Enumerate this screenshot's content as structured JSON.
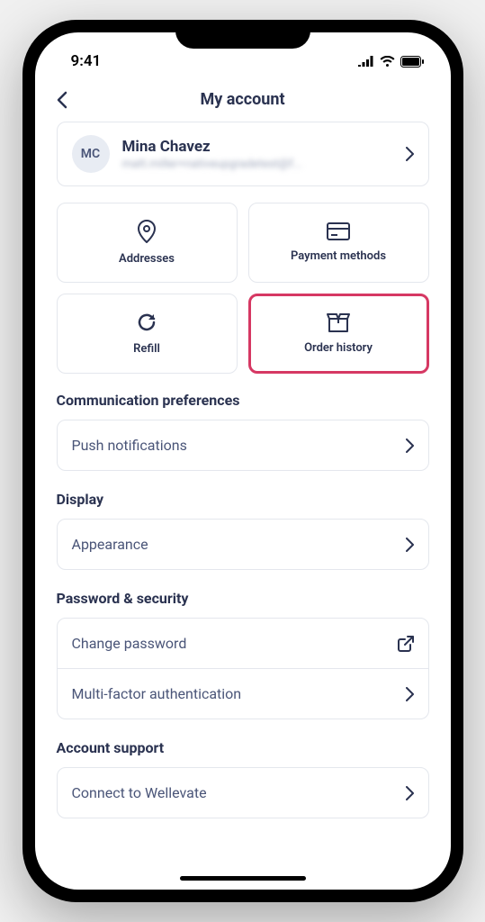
{
  "statusBar": {
    "time": "9:41"
  },
  "header": {
    "title": "My account"
  },
  "profile": {
    "initials": "MC",
    "name": "Mina Chavez",
    "email": "matt.miller+nativeupgradetest@f..."
  },
  "tiles": [
    {
      "label": "Addresses"
    },
    {
      "label": "Payment methods"
    },
    {
      "label": "Refill"
    },
    {
      "label": "Order history"
    }
  ],
  "sections": {
    "communication": {
      "title": "Communication preferences",
      "items": [
        {
          "label": "Push notifications"
        }
      ]
    },
    "display": {
      "title": "Display",
      "items": [
        {
          "label": "Appearance"
        }
      ]
    },
    "security": {
      "title": "Password & security",
      "items": [
        {
          "label": "Change password"
        },
        {
          "label": "Multi-factor authentication"
        }
      ]
    },
    "support": {
      "title": "Account support",
      "items": [
        {
          "label": "Connect to Wellevate"
        }
      ]
    }
  }
}
